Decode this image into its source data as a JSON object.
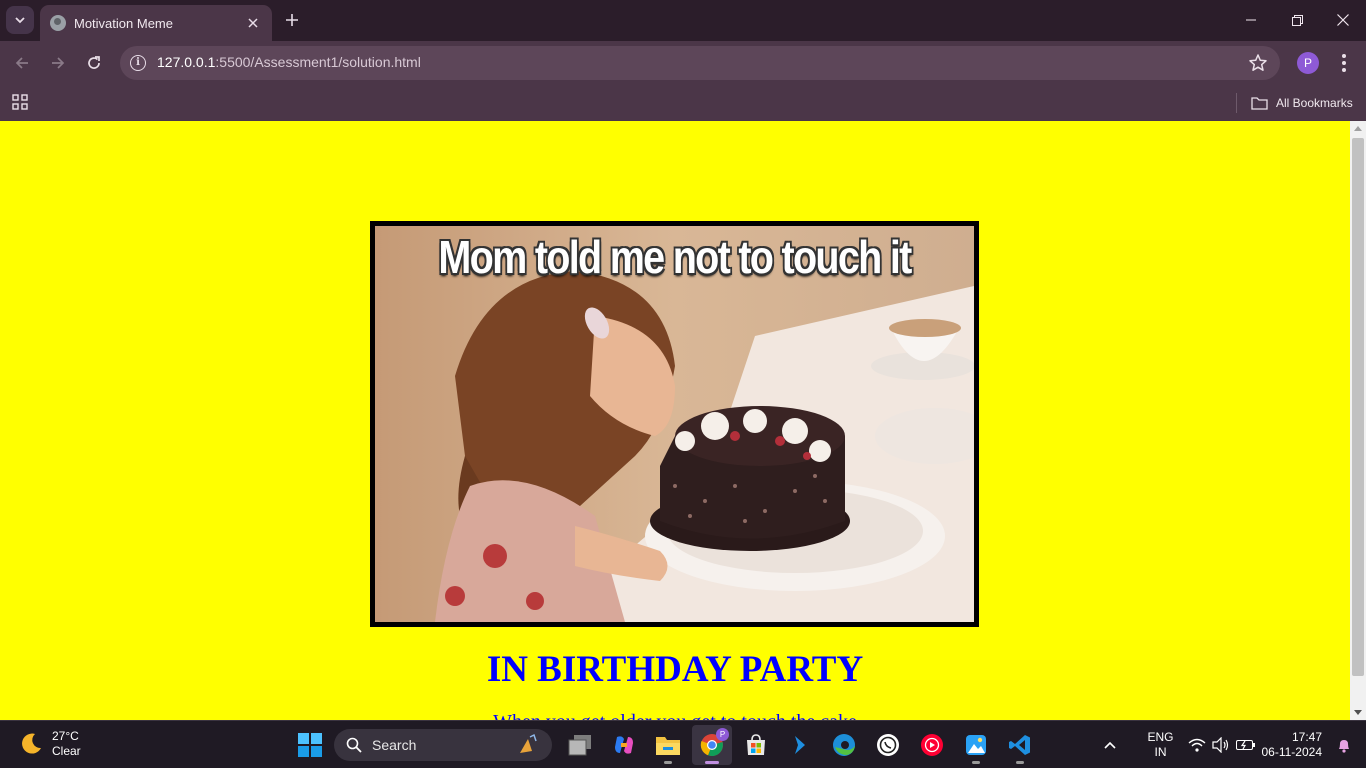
{
  "browser": {
    "tab_title": "Motivation Meme",
    "url_host": "127.0.0.1",
    "url_rest": ":5500/Assessment1/solution.html",
    "profile_initial": "P",
    "bookmarks_folder": "All Bookmarks"
  },
  "page": {
    "meme_caption": "Mom told me not to touch it",
    "heading": "IN BIRTHDAY PARTY",
    "text_partial": "When you get older you get to touch the cake",
    "background_color": "#ffff00",
    "text_color": "#0000ff"
  },
  "taskbar": {
    "weather_temp": "27°C",
    "weather_desc": "Clear",
    "search_label": "Search",
    "lang_primary": "ENG",
    "lang_secondary": "IN",
    "time": "17:47",
    "date": "06-11-2024",
    "apps": [
      "widgets-icon",
      "copilot-icon",
      "file-explorer-icon",
      "chrome-icon",
      "microsoft-store-icon",
      "azure-icon",
      "edge-icon",
      "whatsapp-icon",
      "youtube-music-icon",
      "photos-icon",
      "vscode-icon"
    ]
  }
}
